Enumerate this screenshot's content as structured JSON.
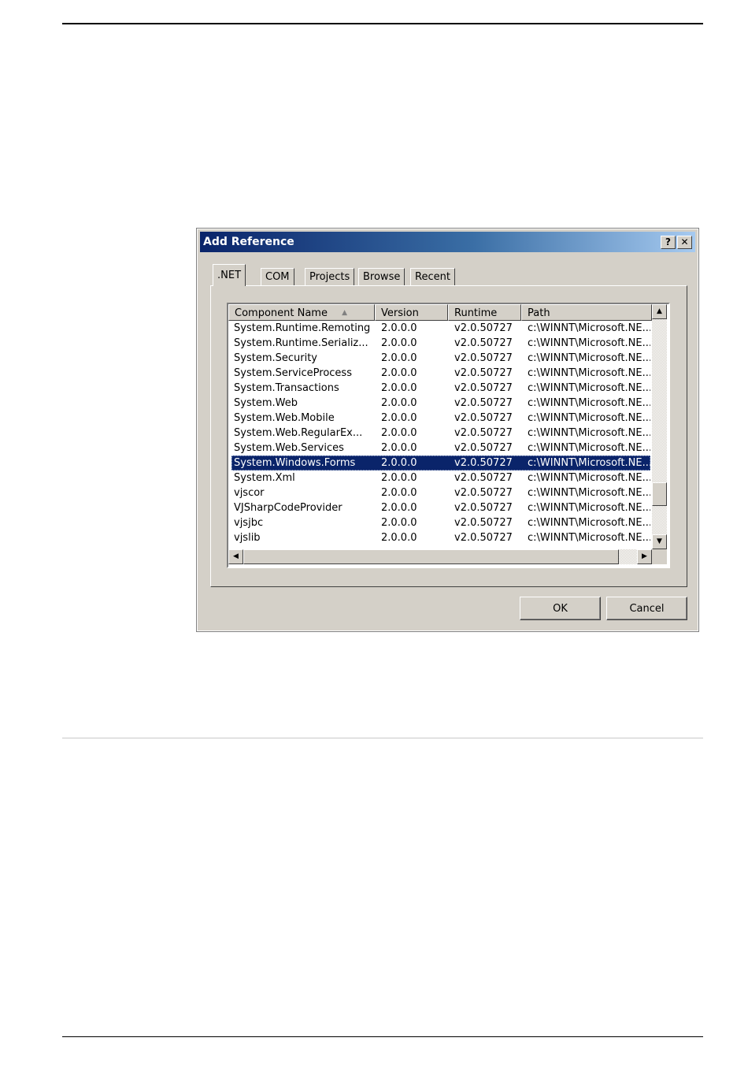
{
  "dialog": {
    "title": "Add Reference",
    "help_glyph": "?",
    "close_glyph": "✕"
  },
  "tabs": [
    {
      "label": ".NET",
      "active": true
    },
    {
      "label": "COM",
      "active": false
    },
    {
      "label": "Projects",
      "active": false
    },
    {
      "label": "Browse",
      "active": false
    },
    {
      "label": "Recent",
      "active": false
    }
  ],
  "list": {
    "columns": [
      "Component Name",
      "Version",
      "Runtime",
      "Path"
    ],
    "sort_glyph": "▲",
    "selected_index": 9,
    "rows": [
      {
        "name": "System.Runtime.Remoting",
        "version": "2.0.0.0",
        "runtime": "v2.0.50727",
        "path": "c:\\WINNT\\Microsoft.NE..."
      },
      {
        "name": "System.Runtime.Serializ...",
        "version": "2.0.0.0",
        "runtime": "v2.0.50727",
        "path": "c:\\WINNT\\Microsoft.NE..."
      },
      {
        "name": "System.Security",
        "version": "2.0.0.0",
        "runtime": "v2.0.50727",
        "path": "c:\\WINNT\\Microsoft.NE..."
      },
      {
        "name": "System.ServiceProcess",
        "version": "2.0.0.0",
        "runtime": "v2.0.50727",
        "path": "c:\\WINNT\\Microsoft.NE..."
      },
      {
        "name": "System.Transactions",
        "version": "2.0.0.0",
        "runtime": "v2.0.50727",
        "path": "c:\\WINNT\\Microsoft.NE..."
      },
      {
        "name": "System.Web",
        "version": "2.0.0.0",
        "runtime": "v2.0.50727",
        "path": "c:\\WINNT\\Microsoft.NE..."
      },
      {
        "name": "System.Web.Mobile",
        "version": "2.0.0.0",
        "runtime": "v2.0.50727",
        "path": "c:\\WINNT\\Microsoft.NE..."
      },
      {
        "name": "System.Web.RegularEx...",
        "version": "2.0.0.0",
        "runtime": "v2.0.50727",
        "path": "c:\\WINNT\\Microsoft.NE..."
      },
      {
        "name": "System.Web.Services",
        "version": "2.0.0.0",
        "runtime": "v2.0.50727",
        "path": "c:\\WINNT\\Microsoft.NE..."
      },
      {
        "name": "System.Windows.Forms",
        "version": "2.0.0.0",
        "runtime": "v2.0.50727",
        "path": "c:\\WINNT\\Microsoft.NE..."
      },
      {
        "name": "System.Xml",
        "version": "2.0.0.0",
        "runtime": "v2.0.50727",
        "path": "c:\\WINNT\\Microsoft.NE..."
      },
      {
        "name": "vjscor",
        "version": "2.0.0.0",
        "runtime": "v2.0.50727",
        "path": "c:\\WINNT\\Microsoft.NE..."
      },
      {
        "name": "VJSharpCodeProvider",
        "version": "2.0.0.0",
        "runtime": "v2.0.50727",
        "path": "c:\\WINNT\\Microsoft.NE..."
      },
      {
        "name": "vjsjbc",
        "version": "2.0.0.0",
        "runtime": "v2.0.50727",
        "path": "c:\\WINNT\\Microsoft.NE..."
      },
      {
        "name": "vjslib",
        "version": "2.0.0.0",
        "runtime": "v2.0.50727",
        "path": "c:\\WINNT\\Microsoft.NE..."
      }
    ]
  },
  "scroll": {
    "up": "▲",
    "down": "▼",
    "left": "◀",
    "right": "▶"
  },
  "buttons": {
    "ok": "OK",
    "cancel": "Cancel"
  }
}
